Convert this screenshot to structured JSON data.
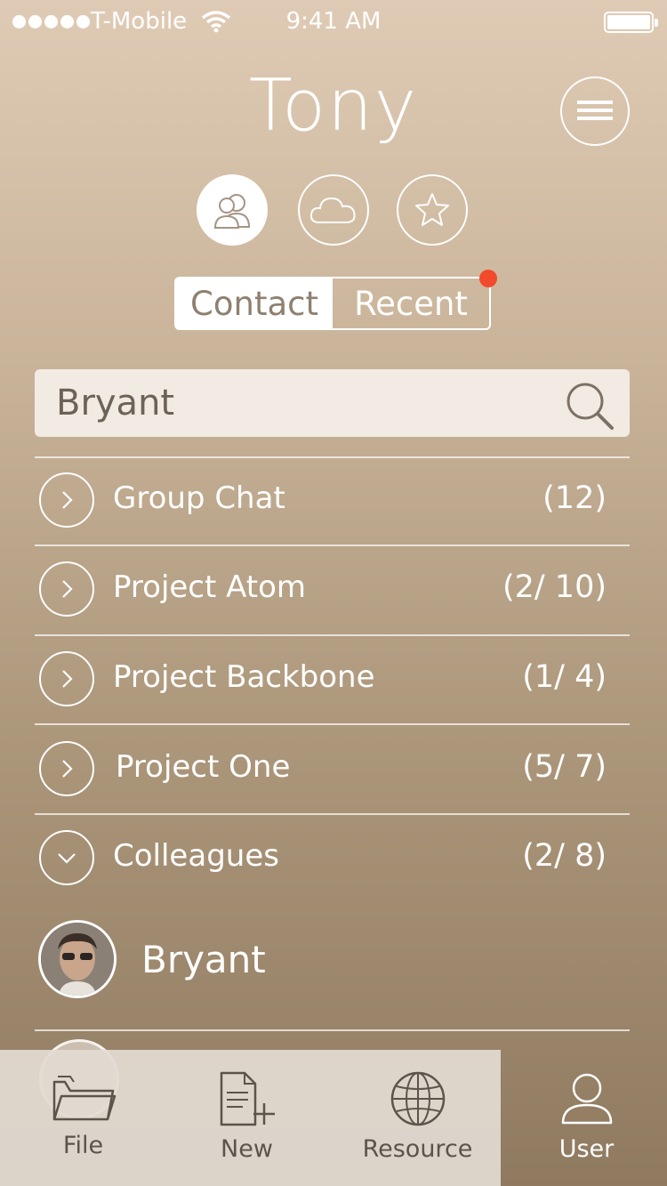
{
  "status_bar": {
    "carrier": "T-Mobile",
    "time": "9:41 AM",
    "signal_bars": 5,
    "icons": [
      "wifi-icon",
      "battery-icon"
    ]
  },
  "header": {
    "user_name": "Tony",
    "menu_icon": "hamburger-menu-icon",
    "view_buttons": [
      "contacts-icon",
      "cloud-icon",
      "star-icon"
    ]
  },
  "segments": {
    "contact_label": "Contact",
    "recent_label": "Recent",
    "selected": "Contact",
    "recent_has_notification": true
  },
  "search": {
    "value": "Bryant",
    "icon": "search-icon"
  },
  "groups": [
    {
      "label": "Group Chat",
      "count": "(12)",
      "expanded": false
    },
    {
      "label": "Project Atom",
      "count": "(2/ 10)",
      "expanded": false
    },
    {
      "label": "Project Backbone",
      "count": "(1/ 4)",
      "expanded": false
    },
    {
      "label": "Project One",
      "count": "(5/ 7)",
      "expanded": false
    },
    {
      "label": "Colleagues",
      "count": "(2/ 8)",
      "expanded": true
    }
  ],
  "contacts": [
    {
      "name": "Bryant"
    }
  ],
  "tab_bar": {
    "tabs": [
      {
        "label": "File",
        "icon": "folder-icon"
      },
      {
        "label": "New",
        "icon": "new-document-icon"
      },
      {
        "label": "Resource",
        "icon": "globe-icon"
      },
      {
        "label": "User",
        "icon": "user-icon"
      }
    ],
    "active": "User"
  },
  "colors": {
    "notification": "#f24a2c",
    "background_top": "#dfcbb5",
    "background_bottom": "#8f7a60"
  }
}
